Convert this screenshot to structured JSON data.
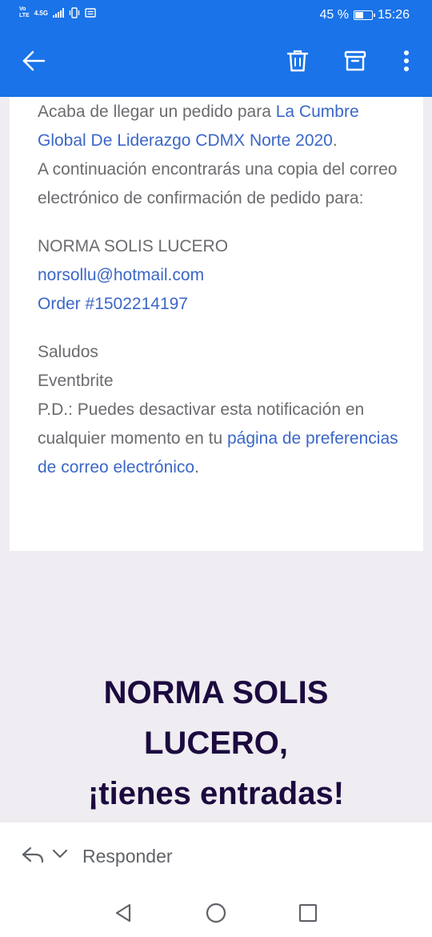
{
  "status_bar": {
    "network_volte": "Vo\nLTE",
    "network_type": "4.5G",
    "battery_percent": "45 %",
    "battery_level": 0.45,
    "time": "15:26"
  },
  "toolbar": {
    "icons": [
      "arrow-back-icon",
      "trash-icon",
      "archive-icon",
      "more-vert-icon"
    ],
    "accent_color": "#1a73e8"
  },
  "email": {
    "intro_prefix": "Acaba de llegar un pedido para ",
    "event_link": "La Cumbre Global De Liderazgo CDMX Norte 2020",
    "intro_suffix": ".",
    "line2": "A continuación encontrarás una copia del correo electrónico de confirmación de pedido para:",
    "buyer_name": "NORMA SOLIS LUCERO",
    "buyer_email": "norsollu@hotmail.com",
    "order_number": "Order #1502214197",
    "greeting": "Saludos",
    "sender": "Eventbrite",
    "ps_prefix": "P.D.: Puedes desactivar esta notificación en cualquier momento en tu ",
    "ps_link": "página de preferencias de correo electrónico",
    "ps_suffix": "."
  },
  "headline": {
    "line1": "NORMA SOLIS",
    "line2": "LUCERO,",
    "line3": "¡tienes entradas!"
  },
  "reply_bar": {
    "label": "Responder"
  }
}
